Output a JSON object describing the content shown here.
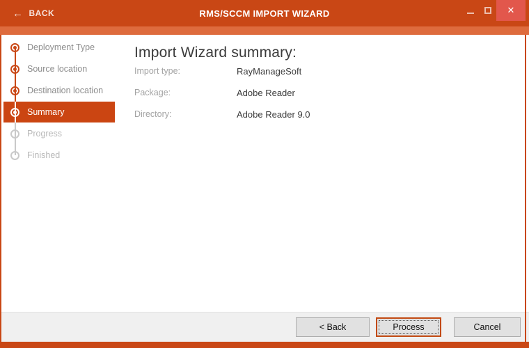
{
  "window": {
    "title": "RMS/SCCM IMPORT WIZARD",
    "back_label": "BACK",
    "icons": {
      "back_arrow": "←",
      "close_glyph": "✕"
    },
    "colors": {
      "titlebar": "#c94715",
      "substrip": "#de6b3d",
      "close_button": "#e2574c",
      "accent": "#cb4512",
      "footer_bg": "#f0f0f0",
      "button_bg": "#e1e1e1"
    }
  },
  "sidebar": {
    "steps": [
      {
        "label": "Deployment Type",
        "state": "done"
      },
      {
        "label": "Source location",
        "state": "done"
      },
      {
        "label": "Destination location",
        "state": "done"
      },
      {
        "label": "Summary",
        "state": "active"
      },
      {
        "label": "Progress",
        "state": "pending"
      },
      {
        "label": "Finished",
        "state": "pending"
      }
    ]
  },
  "main": {
    "heading": "Import Wizard summary:",
    "fields": [
      {
        "label": "Import type:",
        "value": "RayManageSoft"
      },
      {
        "label": "Package:",
        "value": "Adobe Reader"
      },
      {
        "label": "Directory:",
        "value": "Adobe Reader 9.0"
      }
    ]
  },
  "footer": {
    "back_button": "< Back",
    "process_button": "Process",
    "cancel_button": "Cancel"
  }
}
